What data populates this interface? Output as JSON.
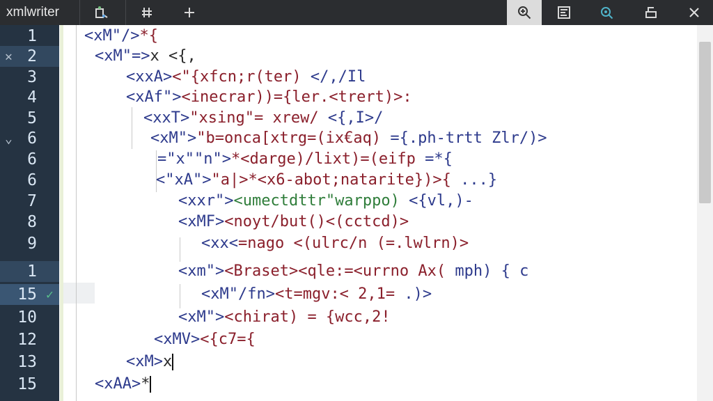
{
  "window": {
    "app_title": "xmlwriter"
  },
  "toolbar": {
    "icons": [
      "bug-run-icon",
      "hash-icon",
      "plus-icon",
      "search-zoom-icon",
      "outline-icon",
      "find-replace-icon",
      "panel-icon",
      "close-icon"
    ]
  },
  "gutter": {
    "lines": [
      {
        "num": "1",
        "marker": "",
        "check": ""
      },
      {
        "num": "2",
        "marker": "✕",
        "check": ""
      },
      {
        "num": "3",
        "marker": "",
        "check": ""
      },
      {
        "num": "4",
        "marker": "",
        "check": ""
      },
      {
        "num": "5",
        "marker": "",
        "check": ""
      },
      {
        "num": "6",
        "marker": "⌄",
        "check": ""
      },
      {
        "num": "6",
        "marker": "",
        "check": ""
      },
      {
        "num": "6",
        "marker": "",
        "check": ""
      },
      {
        "num": "7",
        "marker": "",
        "check": ""
      },
      {
        "num": "8",
        "marker": "",
        "check": ""
      },
      {
        "num": "9",
        "marker": "",
        "check": ""
      },
      {
        "num": "1",
        "marker": "",
        "check": ""
      },
      {
        "num": "15",
        "marker": "",
        "check": "✓"
      },
      {
        "num": "10",
        "marker": "",
        "check": ""
      },
      {
        "num": "12",
        "marker": "",
        "check": ""
      },
      {
        "num": "13",
        "marker": "",
        "check": ""
      },
      {
        "num": "15",
        "marker": "",
        "check": ""
      }
    ]
  },
  "code": {
    "lines": [
      {
        "tag": "<xM\"/>",
        "rest": "*{",
        "rest_class": "tk-attr",
        "tail": ""
      },
      {
        "tag": "<xM\"=>",
        "rest": "x <{,",
        "rest_class": "tk-txt",
        "tail": ""
      },
      {
        "tag": "<xxA>",
        "rest": "<\"{xfcn;r(ter)",
        "rest_class": "tk-attr",
        "tail": " </,/Il"
      },
      {
        "tag": "<xAf\">",
        "rest": "<inecrar))={ler.<trert)>:",
        "rest_class": "tk-attr",
        "tail": ""
      },
      {
        "tag": "<xxT>",
        "rest": "\"xsing\"= xrew/",
        "rest_class": "tk-attr",
        "tail": " <{,I>/"
      },
      {
        "tag": "<xM\">",
        "rest": "\"b=onca[xtrg=(ix€aq)",
        "rest_class": "tk-attr",
        "tail": " ={.ph-trtt Zlr/)>"
      },
      {
        "tag": "=\"x\"\"n\">",
        "rest": "*<darge)/lixt)=(eifp",
        "rest_class": "tk-attr",
        "tail": " =*{"
      },
      {
        "tag": "<\"xA\">",
        "rest": "\"a|>*<x6-abot;natarite})>{",
        "rest_class": "tk-attr",
        "tail": " ...}"
      },
      {
        "tag": "<xxr\">",
        "rest": "<umectdttr\"warppo)",
        "rest_class": "tk-str",
        "tail": " <{vl,)-"
      },
      {
        "tag": "<xMF>",
        "rest": "<noyt/but()<(cctcd)>",
        "rest_class": "tk-attr",
        "tail": ""
      },
      {
        "tag": "<xx<",
        "rest": "=nago <(ulrc/n (=.lwlrn)>",
        "rest_class": "tk-attr",
        "tail": ""
      },
      {
        "tag": "<xm\">",
        "rest": "<Braset><qle:=<urrno Ax(",
        "rest_class": "tk-attr",
        "tail": " mph) { c"
      },
      {
        "tag": "<xM\"/fn>",
        "rest": "<t=mgv:< 2,1=",
        "rest_class": "tk-attr",
        "tail": " .)>"
      },
      {
        "tag": "<xM\">",
        "rest": "<chirat) = {wcc,2!",
        "rest_class": "tk-attr",
        "tail": ""
      },
      {
        "tag": "<xMV>",
        "rest": "<{c7={",
        "rest_class": "tk-attr",
        "tail": ""
      },
      {
        "tag": "<xM>",
        "rest": "x",
        "rest_class": "tk-txt",
        "tail": ""
      },
      {
        "tag": "<xAA>",
        "rest": "*",
        "rest_class": "tk-txt",
        "tail": ""
      }
    ]
  }
}
